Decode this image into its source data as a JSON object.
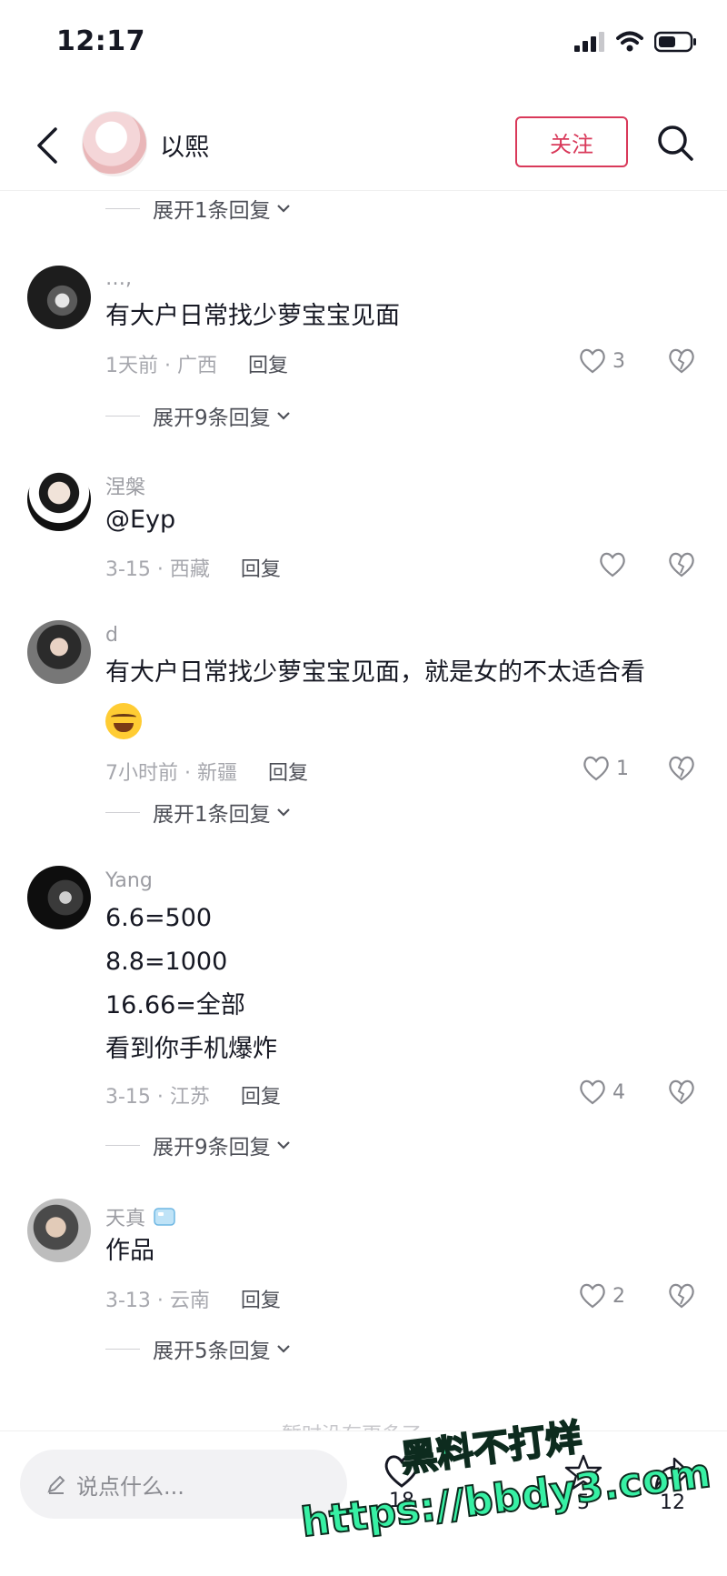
{
  "status_bar": {
    "time": "12:17"
  },
  "header": {
    "user_name": "以熙",
    "follow_label": "关注"
  },
  "top_expand": "展开1条回复",
  "comments": [
    {
      "name": "…,",
      "text": [
        "有大户日常找少萝宝宝见面"
      ],
      "time": "1天前 · 广西",
      "reply": "回复",
      "likes": "3",
      "expand": "展开9条回复"
    },
    {
      "name": "涅槃",
      "text": [
        "@Eyp"
      ],
      "time": "3-15 · 西藏",
      "reply": "回复",
      "likes": "",
      "expand": ""
    },
    {
      "name": "d",
      "text": [
        "有大户日常找少萝宝宝见面，就是女的不太适合看"
      ],
      "emoji": "laughing-tears",
      "time": "7小时前 · 新疆",
      "reply": "回复",
      "likes": "1",
      "expand": "展开1条回复"
    },
    {
      "name": "Yang",
      "text": [
        "6.6=500",
        "8.8=1000",
        "16.66=全部",
        "看到你手机爆炸"
      ],
      "time": "3-15 · 江苏",
      "reply": "回复",
      "likes": "4",
      "expand": "展开9条回复"
    },
    {
      "name": "天真",
      "badge": "ice-cube",
      "text": [
        "作品"
      ],
      "time": "3-13 · 云南",
      "reply": "回复",
      "likes": "2",
      "expand": "展开5条回复"
    }
  ],
  "footer_hint": "暂时没有更多了",
  "bottom_bar": {
    "input_placeholder": "说点什么...",
    "like_count": "18",
    "collect_count": "5",
    "share_count": "12"
  },
  "watermark": {
    "line1": "黑料不打烊",
    "line2": "https://bbdy3.com"
  },
  "colors": {
    "accent": "#d9395a",
    "watermark": "#37f0a4",
    "muted": "#a6a7ad"
  },
  "icons": [
    "back-arrow-icon",
    "search-icon",
    "heart-icon",
    "broken-heart-icon",
    "pencil-icon",
    "star-icon",
    "share-icon",
    "chevron-down-icon"
  ]
}
